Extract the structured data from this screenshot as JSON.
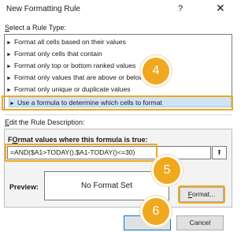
{
  "window": {
    "title": "New Formatting Rule",
    "help_glyph": "?",
    "close_glyph": "✕"
  },
  "rule_type": {
    "label_prefix": "S",
    "label_rest": "elect a Rule Type:",
    "arrow_glyph": "►",
    "items": [
      {
        "label": "Format all cells based on their values"
      },
      {
        "label": "Format only cells that contain"
      },
      {
        "label": "Format only top or bottom ranked values"
      },
      {
        "label": "Format only values that are above or below average"
      },
      {
        "label": "Format only unique or duplicate values"
      },
      {
        "label": "Use a formula to determine which cells to format"
      }
    ],
    "selected_index": 5
  },
  "description": {
    "label_prefix": "E",
    "label_rest": "dit the Rule Description:",
    "formula_label_prefix": "O",
    "formula_label_before": "F",
    "formula_label_rest": "rmat values where this formula is true:",
    "formula_value": "=AND($A1>TODAY(),$A1-TODAY()<=30)",
    "collapse_glyph": "⭱"
  },
  "preview": {
    "label_prefix": "Preview:",
    "sample_text": "No Format Set"
  },
  "buttons": {
    "format_ul": "F",
    "format_rest": "ormat...",
    "ok_label": "",
    "cancel_label": "Cancel"
  },
  "steps": {
    "step4": "4",
    "step5": "5",
    "step6": "6"
  },
  "colors": {
    "highlight": "#f0a81e",
    "selection": "#cfe3f6"
  }
}
